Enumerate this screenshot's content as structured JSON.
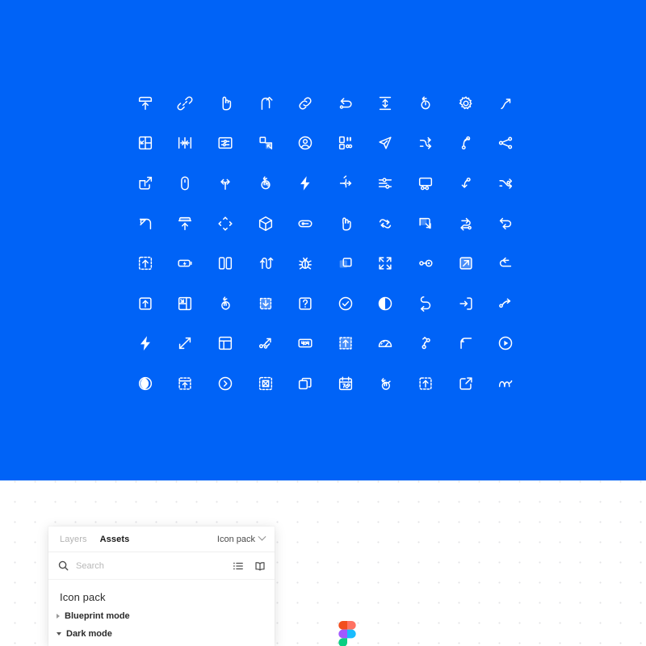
{
  "artboard": {
    "background_color": "#0063f7",
    "icon_color": "#ffffff",
    "grid_columns": 10,
    "grid_rows": 8,
    "icons": [
      "upload-box-icon",
      "broken-link-icon",
      "pointing-hand-icon",
      "arrow-u-turn-up-icon",
      "link-icon",
      "undo-path-icon",
      "vertical-resize-icon",
      "rotate-click-icon",
      "gear-icon",
      "wavy-arrow-up-icon",
      "layout-drag-icon",
      "collapse-horizontal-icon",
      "settings-frame-icon",
      "select-region-icon",
      "user-circle-icon",
      "dashboard-blocks-icon",
      "send-cursor-icon",
      "shuffle-arrows-icon",
      "node-path-up-icon",
      "share-nodes-icon",
      "external-frame-icon",
      "mouse-icon",
      "branch-split-icon",
      "click-hold-icon",
      "lightning-bolt-icon",
      "branch-arrow-icon",
      "sliders-icon",
      "screen-dots-icon",
      "node-corner-arrow-icon",
      "split-path-icon",
      "arrow-expand-corner-icon",
      "upload-frame-icon",
      "move-diamond-icon",
      "cube-icon",
      "pill-toggle-icon",
      "two-finger-tap-icon",
      "refresh-loop-icon",
      "frame-resize-icon",
      "swap-path-icon",
      "return-path-icon",
      "upload-dashed-box-icon",
      "battery-bolt-icon",
      "columns-two-icon",
      "wave-path-icon",
      "bug-icon",
      "duplicate-square-icon",
      "expand-arrows-icon",
      "node-connect-icon",
      "arrow-box-filled-icon",
      "undo-arrow-icon",
      "upload-square-icon",
      "layout-resize-icon",
      "tap-gesture-icon",
      "select-download-icon",
      "help-box-icon",
      "check-circle-icon",
      "toggle-on-icon",
      "undo-loop-icon",
      "login-door-icon",
      "bezier-path-icon",
      "lightning-icon",
      "diagonal-resize-icon",
      "layout-panels-icon",
      "path-branch-icon",
      "error-404-icon",
      "select-upload-icon",
      "gauge-icon",
      "node-drag-icon",
      "corner-bracket-icon",
      "play-circle-icon",
      "eye-target-icon",
      "upload-panel-icon",
      "chevron-right-circle-icon",
      "scan-fullscreen-icon",
      "copy-icon",
      "calendar-27-icon",
      "swipe-gesture-icon",
      "upload-dashed-icon",
      "external-link-icon",
      "squiggle-path-icon"
    ]
  },
  "assets_panel": {
    "tabs": [
      {
        "label": "Layers",
        "active": false
      },
      {
        "label": "Assets",
        "active": true
      }
    ],
    "document_selector": {
      "label": "Icon pack",
      "icon": "chevron-down-icon"
    },
    "search": {
      "placeholder": "Search",
      "value": "",
      "icon": "search-icon"
    },
    "view_toggles": [
      {
        "name": "list-view-icon"
      },
      {
        "name": "library-book-icon"
      }
    ],
    "pack_title": "Icon pack",
    "sections": [
      {
        "label": "Blueprint mode",
        "expanded": false
      },
      {
        "label": "Dark mode",
        "expanded": true
      }
    ]
  },
  "canvas": {
    "background_color": "#ffffff",
    "dot_color": "#e3e3e6"
  },
  "figma_logo": {
    "name": "figma-logo",
    "colors": {
      "red": "#f24e1e",
      "orange": "#ff7262",
      "purple": "#a259ff",
      "blue": "#1abcfe",
      "green": "#0acf83"
    }
  }
}
